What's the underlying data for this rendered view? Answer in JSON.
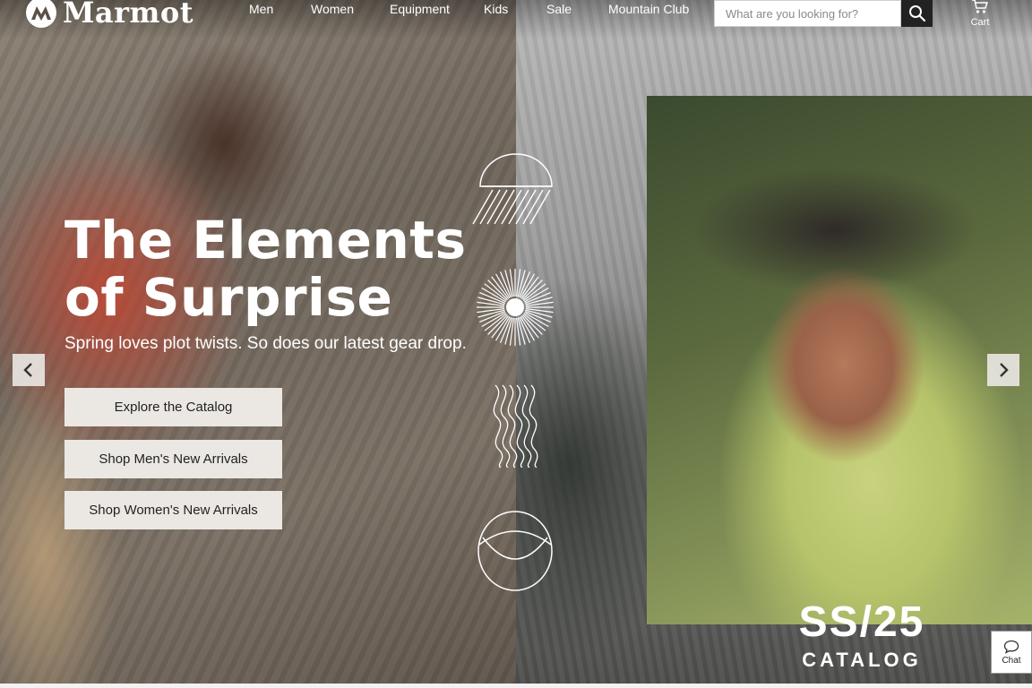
{
  "brand": {
    "name": "Marmot"
  },
  "nav": {
    "items": [
      {
        "label": "Men"
      },
      {
        "label": "Women"
      },
      {
        "label": "Equipment"
      },
      {
        "label": "Kids"
      },
      {
        "label": "Sale"
      },
      {
        "label": "Mountain Club"
      }
    ]
  },
  "search": {
    "placeholder": "What are you looking for?",
    "value": ""
  },
  "cart": {
    "label": "Cart"
  },
  "hero": {
    "headline": "The Elements of Surprise",
    "subline": "Spring loves plot twists. So does our latest gear drop.",
    "ctas": [
      {
        "label": "Explore the Catalog"
      },
      {
        "label": "Shop Men's New Arrivals"
      },
      {
        "label": "Shop Women's New Arrivals"
      }
    ]
  },
  "catalog_badge": {
    "season": "SS/25",
    "label": "CATALOG"
  },
  "chat": {
    "label": "Chat"
  },
  "icons": {
    "search": "search-icon",
    "cart": "cart-icon",
    "prev": "chevron-left-icon",
    "next": "chevron-right-icon",
    "chat": "chat-bubble-icon"
  },
  "colors": {
    "cta_bg": "#ebe8e3",
    "search_button": "#222222",
    "text_light": "#ffffff"
  }
}
